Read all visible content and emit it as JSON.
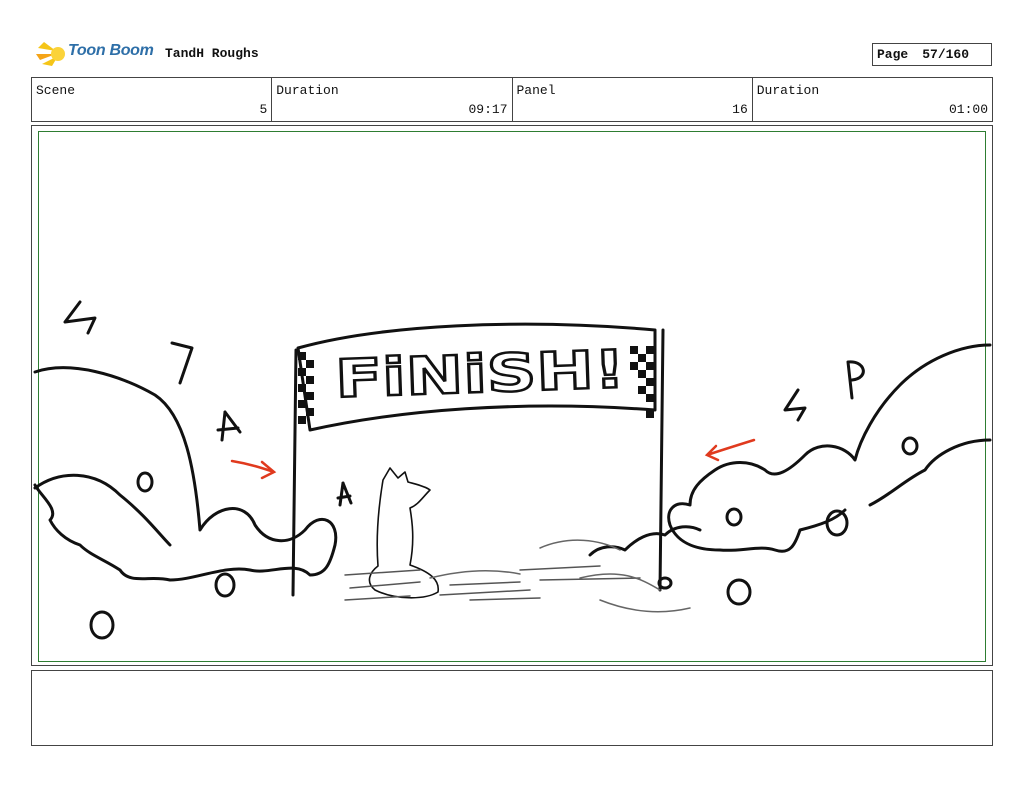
{
  "header": {
    "logo_text": "Toon Boom",
    "project_title": "TandH Roughs",
    "page_label": "Page",
    "page_number": "57/160"
  },
  "info": [
    {
      "label": "Scene",
      "value": "5"
    },
    {
      "label": "Duration",
      "value": "09:17"
    },
    {
      "label": "Panel",
      "value": "16"
    },
    {
      "label": "Duration",
      "value": "01:00"
    }
  ],
  "panel": {
    "sign_text": "FiNiSH!",
    "frame_color": "#2e7d32",
    "arrow_color": "#e03a1e"
  },
  "notes": {
    "text": ""
  }
}
